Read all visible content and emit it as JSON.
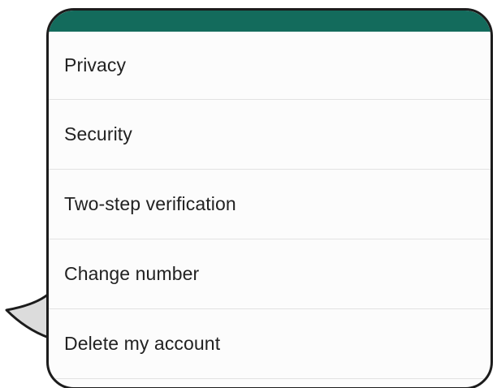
{
  "colors": {
    "header_accent": "#136b5c",
    "card_background": "#fcfcfc",
    "card_outline": "#1c1c1c",
    "divider": "#e2e2e2",
    "item_text": "#222222",
    "tail_fill": "#dcdcdc"
  },
  "settings_menu": {
    "items": [
      {
        "label": "Privacy"
      },
      {
        "label": "Security"
      },
      {
        "label": "Two-step verification"
      },
      {
        "label": "Change number"
      },
      {
        "label": "Delete my account"
      }
    ]
  }
}
